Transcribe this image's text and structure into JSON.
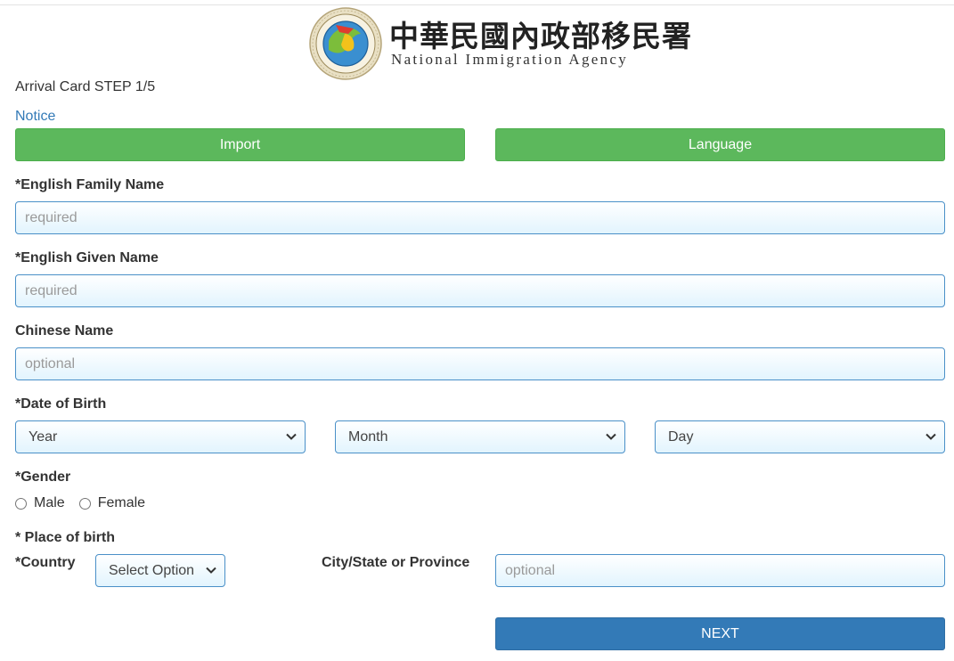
{
  "header": {
    "agency_name_cn": "中華民國內政部移民署",
    "agency_name_en": "National Immigration Agency",
    "seal_text": "National Immigration Agency"
  },
  "step_title": "Arrival Card STEP 1/5",
  "notice_link": "Notice",
  "buttons": {
    "import": "Import",
    "language": "Language",
    "next": "NEXT"
  },
  "fields": {
    "family_name": {
      "label": "*English Family Name",
      "placeholder": "required",
      "value": ""
    },
    "given_name": {
      "label": "*English Given Name",
      "placeholder": "required",
      "value": ""
    },
    "chinese_name": {
      "label": "Chinese Name",
      "placeholder": "optional",
      "value": ""
    },
    "dob": {
      "label": "*Date of Birth",
      "year": "Year",
      "month": "Month",
      "day": "Day"
    },
    "gender": {
      "label": "*Gender",
      "options": [
        "Male",
        "Female"
      ],
      "selected": null
    },
    "place_of_birth": {
      "label": "* Place of birth",
      "country_label": "*Country",
      "country_value": "Select Option",
      "city_label": "City/State or Province",
      "city_placeholder": "optional",
      "city_value": ""
    }
  },
  "colors": {
    "green_button": "#5cb85c",
    "blue_button": "#337ab7",
    "link": "#337ab7",
    "input_border": "#4a90c8"
  }
}
